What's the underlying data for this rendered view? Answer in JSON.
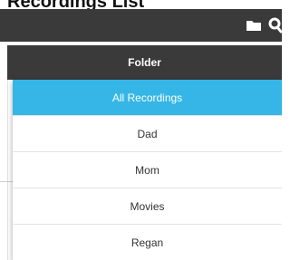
{
  "header": {
    "title_fragment": "Recordings List",
    "icons": [
      "folder-icon",
      "search-icon"
    ]
  },
  "folder_header": {
    "label": "Folder"
  },
  "dropdown": {
    "selected": "All Recordings",
    "items": [
      {
        "label": "All Recordings"
      },
      {
        "label": "Dad"
      },
      {
        "label": "Mom"
      },
      {
        "label": "Movies"
      },
      {
        "label": "Regan"
      }
    ]
  },
  "colors": {
    "app_bar": "#3a3a3a",
    "selected_item": "#35b6e6",
    "item_text": "#333333"
  }
}
